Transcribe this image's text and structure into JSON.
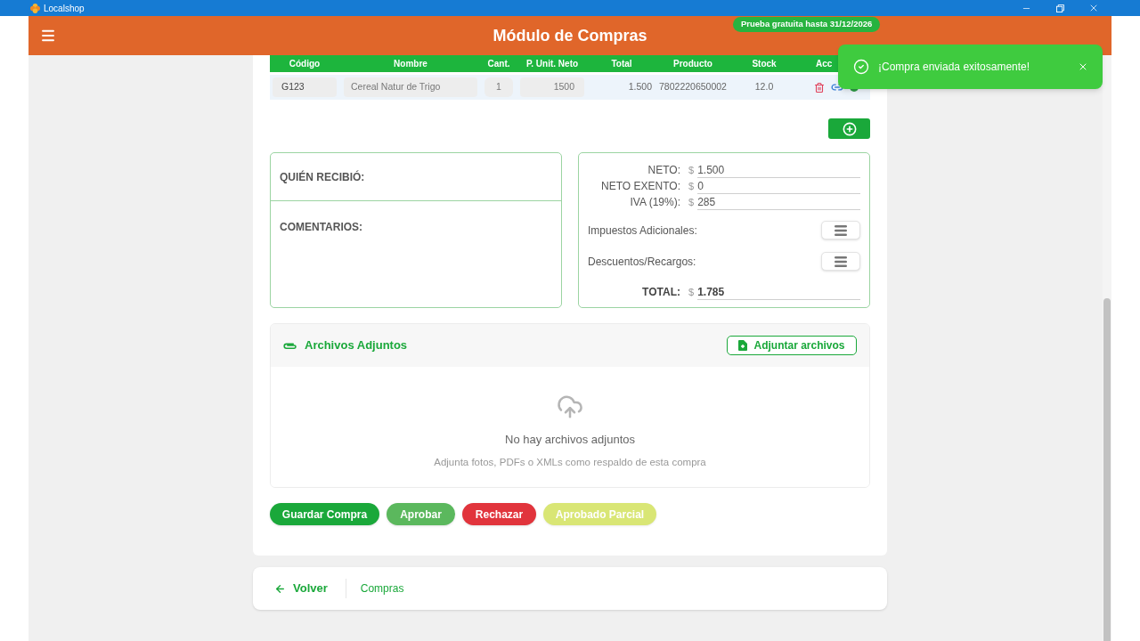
{
  "window": {
    "title": "Localshop"
  },
  "header": {
    "title": "Módulo de Compras",
    "trial_badge": "Prueba gratuita hasta 31/12/2026"
  },
  "items_table": {
    "columns": [
      "Código",
      "Nombre",
      "Cant.",
      "P. Unit. Neto",
      "Total",
      "Producto",
      "Stock",
      "Acc"
    ],
    "rows": [
      {
        "code": "G123",
        "name": "Cereal Natur de Trigo",
        "quantity": "1",
        "unit_price": "1500",
        "total": "1.500",
        "product": "7802220650002",
        "stock": "12.0"
      }
    ]
  },
  "reception": {
    "received_by_label": "QUIÉN RECIBIÓ:",
    "comments_label": "COMENTARIOS:"
  },
  "totals": {
    "lines": [
      {
        "kind": "amount",
        "label": "NETO:",
        "currency": "$",
        "value": "1.500"
      },
      {
        "kind": "amount",
        "label": "NETO EXENTO:",
        "currency": "$",
        "value": "0"
      },
      {
        "kind": "amount",
        "label": "IVA (19%):",
        "currency": "$",
        "value": "285"
      },
      {
        "kind": "menu",
        "label": "Impuestos Adicionales:"
      },
      {
        "kind": "menu",
        "label": "Descuentos/Recargos:"
      },
      {
        "kind": "total",
        "label": "TOTAL:",
        "currency": "$",
        "value": "1.785"
      }
    ]
  },
  "attachments": {
    "title": "Archivos Adjuntos",
    "add_button": "Adjuntar archivos",
    "empty_title": "No hay archivos adjuntos",
    "empty_hint": "Adjunta fotos, PDFs o XMLs como respaldo de esta compra"
  },
  "actions": [
    {
      "kind": "save",
      "label": "Guardar Compra",
      "disabled": false
    },
    {
      "kind": "approve",
      "label": "Aprobar",
      "disabled": false
    },
    {
      "kind": "reject",
      "label": "Rechazar",
      "disabled": false
    },
    {
      "kind": "partial",
      "label": "Aprobado Parcial",
      "disabled": true
    }
  ],
  "footer": {
    "back": "Volver",
    "breadcrumb": "Compras"
  },
  "toast": {
    "message": "¡Compra enviada exitosamente!"
  }
}
